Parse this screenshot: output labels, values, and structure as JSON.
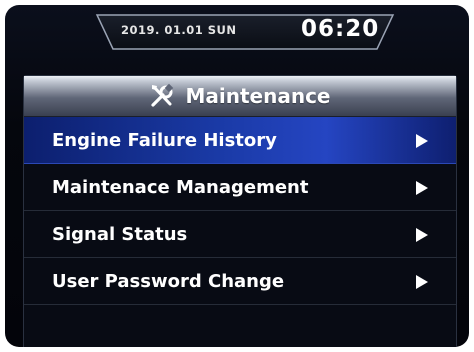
{
  "status_bar": {
    "date": "2019. 01.01 SUN",
    "time": "06:20"
  },
  "panel": {
    "title": "Maintenance",
    "icon": "tools-icon"
  },
  "menu": {
    "items": [
      {
        "label": "Engine Failure History",
        "selected": true
      },
      {
        "label": "Maintenace Management",
        "selected": false
      },
      {
        "label": "Signal Status",
        "selected": false
      },
      {
        "label": "User Password Change",
        "selected": false
      }
    ],
    "arrow_icon": "play-arrow-icon"
  },
  "colors": {
    "background": "#05070d",
    "selected_row": "#1a3aa6",
    "text": "#ffffff"
  }
}
